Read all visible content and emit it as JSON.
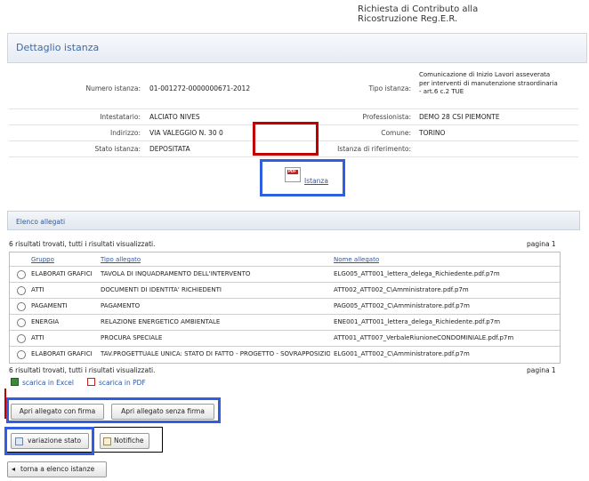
{
  "header": {
    "top_title_line1": "Richiesta di Contributo alla",
    "top_title_line2": "Ricostruzione Reg.E.R."
  },
  "detail": {
    "title": "Dettaglio istanza",
    "numero_istanza_label": "Numero istanza:",
    "numero_istanza_value": "01-001272-0000000671-2012",
    "tipo_istanza_label": "Tipo istanza:",
    "tipo_istanza_value": "Comunicazione di Inizio Lavori asseverata per interventi di manutenzione straordinaria - art.6 c.2 TUE",
    "intestatario_label": "Intestatario:",
    "intestatario_value": "ALCIATO NIVES",
    "professionista_label": "Professionista:",
    "professionista_value": "DEMO 28 CSI PIEMONTE",
    "indirizzo_label": "Indirizzo:",
    "indirizzo_value": "VIA VALEGGIO N. 30 0",
    "comune_label": "Comune:",
    "comune_value": "TORINO",
    "stato_label": "Stato istanza:",
    "stato_value": "DEPOSITATA",
    "riferimento_label": "Istanza di riferimento:",
    "riferimento_value": "",
    "istanza_link": "Istanza"
  },
  "allegati": {
    "bar_title": "Elenco allegati",
    "results_text": "6 risultati trovati, tutti i risultati visualizzati.",
    "page_text": "pagina 1",
    "columns": [
      "Gruppo",
      "Tipo allegato",
      "Nome allegato"
    ],
    "rows": [
      {
        "gruppo": "ELABORATI GRAFICI",
        "tipo": "TAVOLA DI INQUADRAMENTO DELL'INTERVENTO",
        "nome": "ELG005_ATT001_lettera_delega_Richiedente.pdf.p7m"
      },
      {
        "gruppo": "ATTI",
        "tipo": "DOCUMENTI DI IDENTITA' RICHIEDENTI",
        "nome": "ATT002_ATT002_C\\Amministratore.pdf.p7m"
      },
      {
        "gruppo": "PAGAMENTI",
        "tipo": "PAGAMENTO",
        "nome": "PAG005_ATT002_C\\Amministratore.pdf.p7m"
      },
      {
        "gruppo": "ENERGIA",
        "tipo": "RELAZIONE ENERGETICO AMBIENTALE",
        "nome": "ENE001_ATT001_lettera_delega_Richiedente.pdf.p7m"
      },
      {
        "gruppo": "ATTI",
        "tipo": "PROCURA SPECIALE",
        "nome": "ATT001_ATT007_VerbaleRiunioneCONDOMINIALE.pdf.p7m"
      },
      {
        "gruppo": "ELABORATI GRAFICI",
        "tipo": "TAV.PROGETTUALE UNICA: STATO DI FATTO - PROGETTO - SOVRAPPOSIZIONE",
        "nome": "ELG001_ATT002_C\\Amministratore.pdf.p7m"
      }
    ],
    "results_text_bottom": "6 risultati trovati, tutti i risultati visualizzati.",
    "page_text_bottom": "pagina 1",
    "excel_link": "scarica in Excel",
    "pdf_link": "scarica in PDF"
  },
  "buttons": {
    "apri_con_firma": "Apri allegato con firma",
    "apri_senza_firma": "Apri allegato senza firma",
    "variazione_stato": "variazione stato",
    "notifiche": "Notifiche",
    "torna": "torna a elenco istanze"
  },
  "colors": {
    "accent_blue": "#2f5ee0",
    "accent_red": "#c00000",
    "link_blue": "#2b58a8"
  }
}
